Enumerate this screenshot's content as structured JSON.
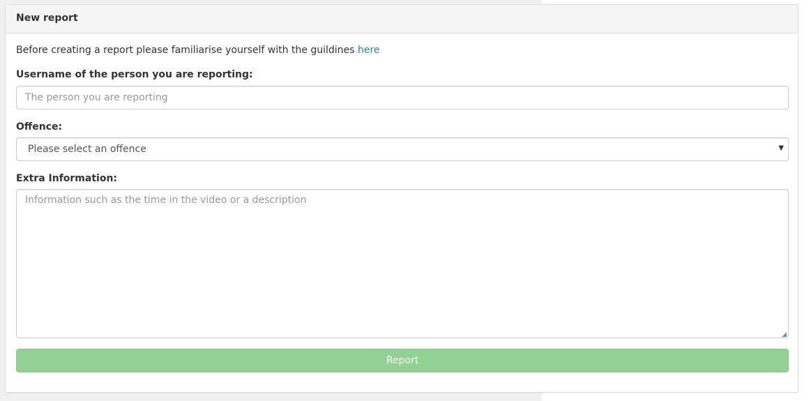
{
  "panel": {
    "title": "New report"
  },
  "intro": {
    "text": "Before creating a report please familiarise yourself with the guildines ",
    "link_text": "here"
  },
  "form": {
    "username_label": "Username of the person you are reporting:",
    "username_placeholder": "The person you are reporting",
    "username_value": "",
    "offence_label": "Offence:",
    "offence_selected": "Please select an offence",
    "extra_label": "Extra Information:",
    "extra_placeholder": "Information such as the time in the video or a description",
    "extra_value": "",
    "submit_label": "Report"
  },
  "icons": {
    "select_caret": "chevron-down-icon",
    "resize_handle": "resize-icon"
  },
  "colors": {
    "link": "#337ab7",
    "button_bg": "#93d093",
    "button_text": "#ffffff"
  }
}
